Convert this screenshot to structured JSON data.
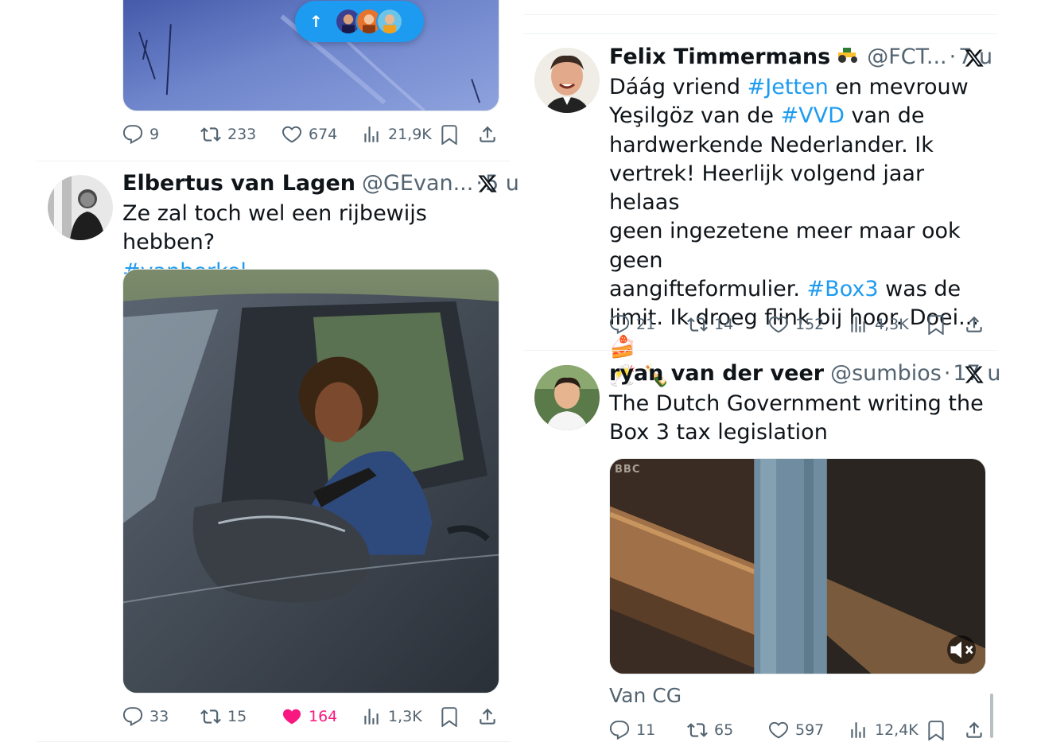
{
  "left_column": {
    "top_tweet": {
      "new_posts_pill": {
        "arrow": "↑",
        "avatar_count": 3
      },
      "actions": {
        "replies": "9",
        "reposts": "233",
        "likes": "674",
        "views": "21,9K"
      }
    },
    "tweet_elbertus": {
      "name": "Elbertus van Lagen",
      "handle": "@GEvan...",
      "dot": "·",
      "time": "5 u",
      "text_line1": "Ze zal toch wel een rijbewijs hebben?",
      "hashtag": "#vanberkel",
      "actions": {
        "replies": "33",
        "reposts": "15",
        "likes": "164",
        "views": "1,3K",
        "liked": true
      }
    }
  },
  "right_column": {
    "tweet_felix": {
      "name": "Felix Timmermans",
      "name_emoji": "tractor-emoji",
      "handle": "@FCT...",
      "dot": "·",
      "time": "7 u",
      "text": {
        "l1_a": "Dáág vriend ",
        "l1_tag": "#Jetten",
        "l1_b": " en mevrouw",
        "l2_a": "Yeşilgöz van de ",
        "l2_tag": "#VVD",
        "l2_b": " van de",
        "l3": "hardwerkende Nederlander. Ik",
        "l4": "vertrek! Heerlijk volgend jaar helaas",
        "l5": "geen ingezetene meer maar ook  geen",
        "l6_a": "aangifteformulier. ",
        "l6_tag": "#Box3",
        "l6_b": " was de",
        "l7": "limit. Ik droeg flink bij hoor. Doei... 🍰",
        "l8": "🥂 🍾"
      },
      "actions": {
        "replies": "21",
        "reposts": "14",
        "likes": "152",
        "views": "4,3K"
      }
    },
    "tweet_ryan": {
      "name": "ryan van der veer",
      "handle": "@sumbios",
      "dot": "·",
      "time": "17 u",
      "text_line1": "The Dutch Government writing the",
      "text_line2": "Box 3 tax legislation",
      "video_watermark": "BBC",
      "attribution": "Van CG",
      "actions": {
        "replies": "11",
        "reposts": "65",
        "likes": "597",
        "views": "12,4K"
      }
    }
  },
  "colors": {
    "accent": "#1d9bf0",
    "like": "#f91880",
    "secondary_text": "#536471"
  }
}
